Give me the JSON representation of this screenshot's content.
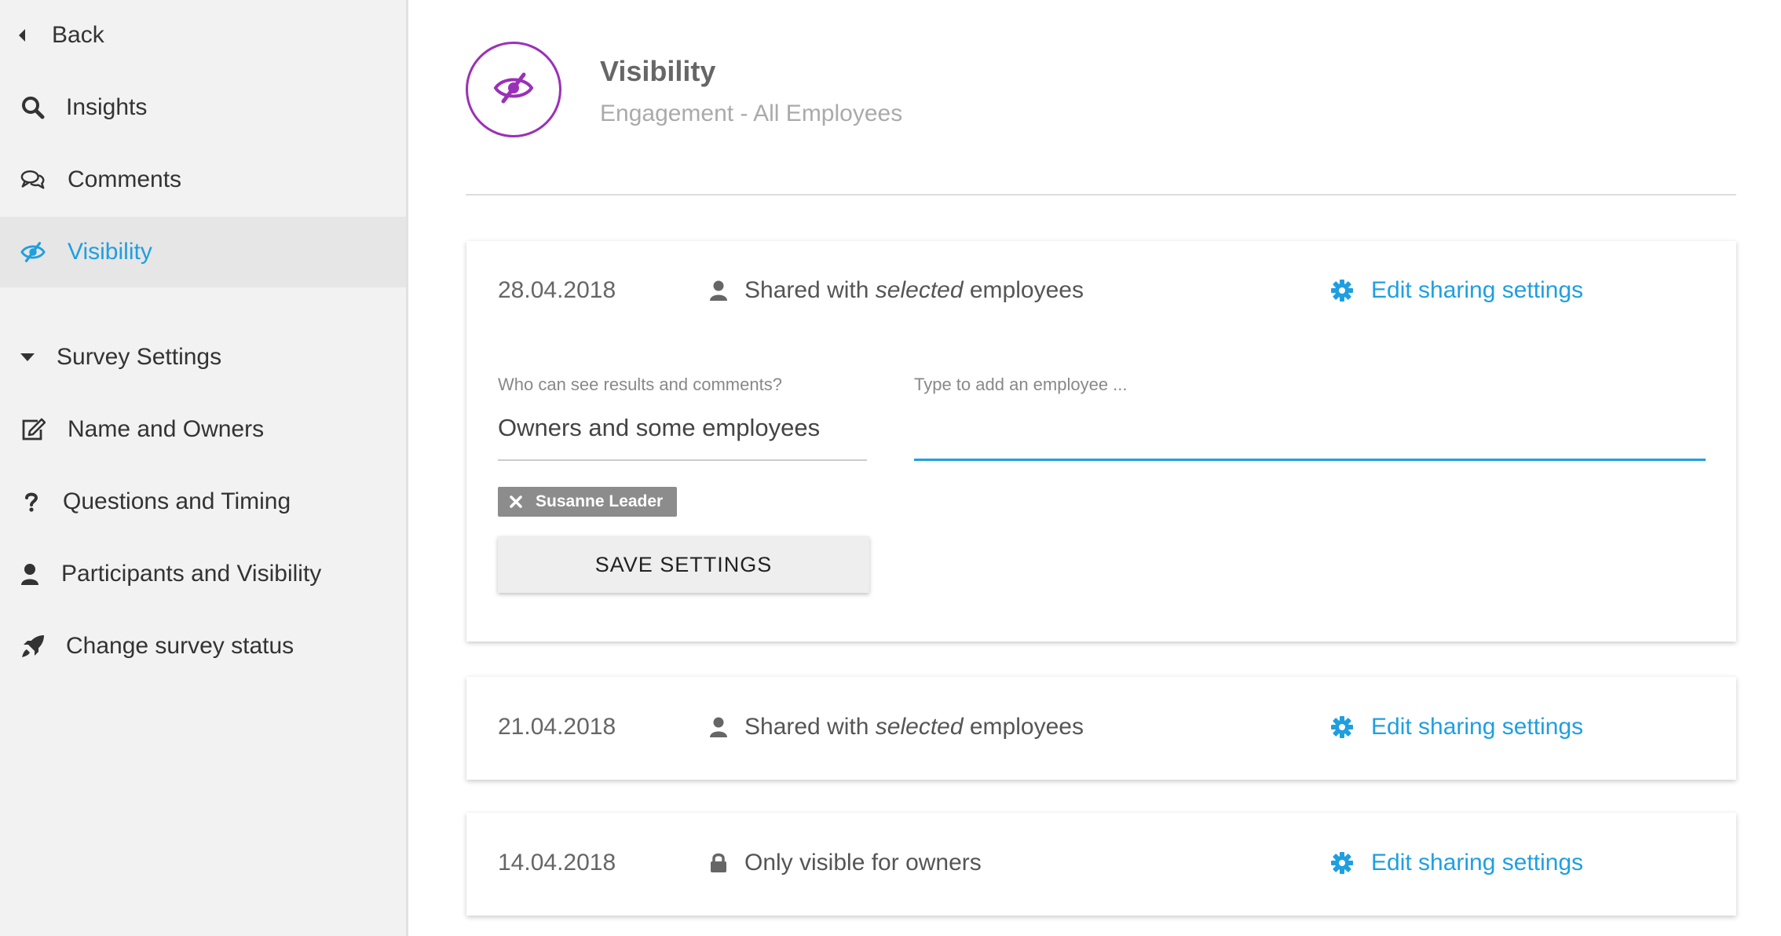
{
  "sidebar": {
    "back": "Back",
    "items": [
      {
        "label": "Insights",
        "icon": "search-icon"
      },
      {
        "label": "Comments",
        "icon": "comments-icon"
      },
      {
        "label": "Visibility",
        "icon": "eye-slash-icon"
      }
    ],
    "survey_settings": "Survey Settings",
    "settings_items": [
      {
        "label": "Name and Owners",
        "icon": "edit-icon"
      },
      {
        "label": "Questions and Timing",
        "icon": "question-icon"
      },
      {
        "label": "Participants and Visibility",
        "icon": "user-icon"
      },
      {
        "label": "Change survey status",
        "icon": "rocket-icon"
      }
    ]
  },
  "header": {
    "title": "Visibility",
    "subtitle": "Engagement - All Employees",
    "icon": "eye-slash-icon"
  },
  "colors": {
    "accent": "#1f9fe0",
    "brand_purple": "#9b30b8",
    "chip_bg": "#8c8c8c"
  },
  "entries": [
    {
      "date": "28.04.2018",
      "share_prefix": "Shared with ",
      "share_em": "selected",
      "share_suffix": " employees",
      "edit_label": "Edit sharing settings"
    },
    {
      "date": "21.04.2018",
      "share_prefix": "Shared with ",
      "share_em": "selected",
      "share_suffix": " employees",
      "edit_label": "Edit sharing settings"
    },
    {
      "date": "14.04.2018",
      "share_text": "Only visible for owners",
      "edit_label": "Edit sharing settings"
    }
  ],
  "form": {
    "who_label": "Who can see results and comments?",
    "who_value": "Owners and some employees",
    "employee_placeholder": "Type to add an employee ...",
    "employee_value": "",
    "chips": [
      "Susanne Leader"
    ],
    "save_label": "SAVE SETTINGS"
  }
}
